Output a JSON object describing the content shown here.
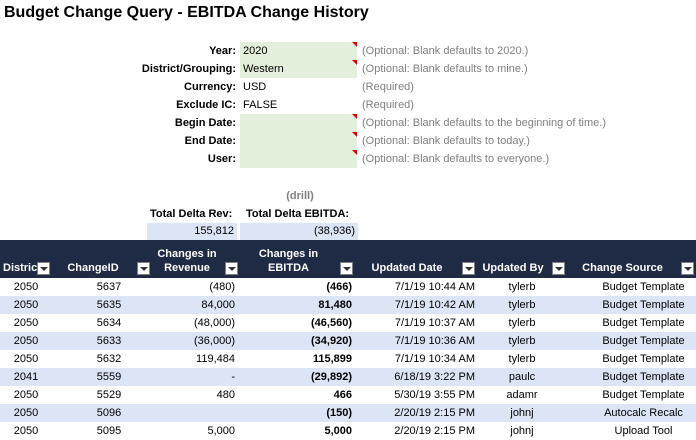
{
  "title": "Budget Change Query - EBITDA Change History",
  "params": [
    {
      "label": "Year:",
      "value": "2020",
      "note": "(Optional: Blank defaults to 2020.)",
      "editable": true
    },
    {
      "label": "District/Grouping:",
      "value": "Western",
      "note": "(Optional: Blank defaults to mine.)",
      "editable": true
    },
    {
      "label": "Currency:",
      "value": "USD",
      "note": "(Required)",
      "editable": false
    },
    {
      "label": "Exclude IC:",
      "value": "FALSE",
      "note": "(Required)",
      "editable": false
    },
    {
      "label": "Begin Date:",
      "value": "",
      "note": "(Optional: Blank defaults to the beginning of time.)",
      "editable": true
    },
    {
      "label": "End Date:",
      "value": "",
      "note": "(Optional: Blank defaults to today.)",
      "editable": true
    },
    {
      "label": "User:",
      "value": "",
      "note": "(Optional: Blank defaults to everyone.)",
      "editable": true
    }
  ],
  "drill": "(drill)",
  "totals": {
    "rev_label": "Total Delta Rev:",
    "ebitda_label": "Total Delta EBITDA:",
    "rev_value": "155,812",
    "ebitda_value": "(38,936)"
  },
  "columns": [
    {
      "line1": "",
      "line2": "District"
    },
    {
      "line1": "",
      "line2": "ChangeID"
    },
    {
      "line1": "Changes in",
      "line2": "Revenue"
    },
    {
      "line1": "Changes in",
      "line2": "EBITDA"
    },
    {
      "line1": "",
      "line2": "Updated Date"
    },
    {
      "line1": "",
      "line2": "Updated By"
    },
    {
      "line1": "",
      "line2": "Change Source"
    }
  ],
  "rows": [
    [
      "2050",
      "5637",
      "(480)",
      "(466)",
      "7/1/19 10:44 AM",
      "tylerb",
      "Budget Template"
    ],
    [
      "2050",
      "5635",
      "84,000",
      "81,480",
      "7/1/19 10:42 AM",
      "tylerb",
      "Budget Template"
    ],
    [
      "2050",
      "5634",
      "(48,000)",
      "(46,560)",
      "7/1/19 10:37 AM",
      "tylerb",
      "Budget Template"
    ],
    [
      "2050",
      "5633",
      "(36,000)",
      "(34,920)",
      "7/1/19 10:36 AM",
      "tylerb",
      "Budget Template"
    ],
    [
      "2050",
      "5632",
      "119,484",
      "115,899",
      "7/1/19 10:34 AM",
      "tylerb",
      "Budget Template"
    ],
    [
      "2041",
      "5559",
      "-",
      "(29,892)",
      "6/18/19 3:22 PM",
      "paulc",
      "Budget Template"
    ],
    [
      "2050",
      "5529",
      "480",
      "466",
      "5/30/19 3:55 PM",
      "adamr",
      "Budget Template"
    ],
    [
      "2050",
      "5096",
      "",
      "(150)",
      "2/20/19 2:15 PM",
      "johnj",
      "Autocalc Recalc"
    ],
    [
      "2050",
      "5095",
      "5,000",
      "5,000",
      "2/20/19 2:15 PM",
      "johnj",
      "Upload Tool"
    ]
  ],
  "colors": {
    "header_bg": "#1f2a44",
    "band": "#dbe5f5",
    "input_bg": "#e2efda",
    "note": "#808080"
  }
}
